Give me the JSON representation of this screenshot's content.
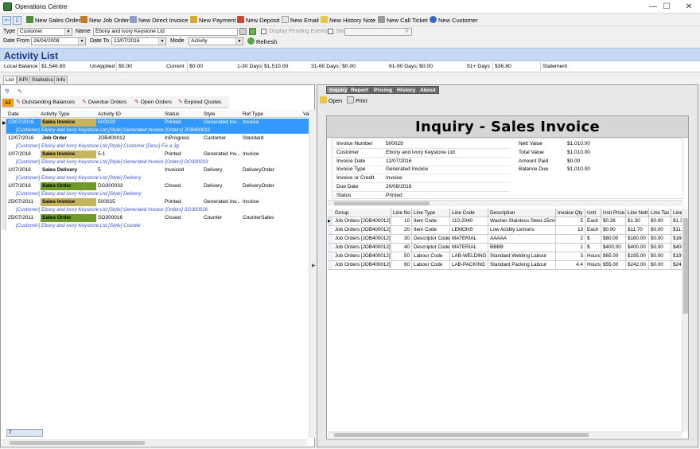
{
  "window": {
    "title": "Operations Centre",
    "minimize": "—",
    "maximize": "☐",
    "close": "✕"
  },
  "toolbar": {
    "new_sales_order": "New Sales Order",
    "new_job_order": "New Job Order",
    "new_direct_invoice": "New Direct Invoice",
    "new_payment": "New Payment",
    "new_deposit": "New Deposit",
    "new_email": "New Email",
    "new_history_note": "New History Note",
    "new_call_ticket": "New Call Ticket",
    "new_customer": "New Customer"
  },
  "filters": {
    "type_label": "Type",
    "type_value": "Customer",
    "name_label": "Name",
    "name_value": "Ebony and Ivory Keystone Ltd",
    "display_pending_label": "Display Pending Events",
    "site_label": "Site",
    "date_from_label": "Date From",
    "date_from_value": "26/04/2008",
    "date_to_label": "Date To",
    "date_to_value": "13/07/2016",
    "mode_label": "Mode",
    "mode_value": "Activity",
    "refresh_label": "Refresh"
  },
  "header": {
    "title": "Activity List"
  },
  "balances": {
    "local_balance_label": "Local Balance",
    "local_balance": "$1,546.80",
    "unapplied_label": "UnApplied",
    "unapplied": "$0.00",
    "current_label": "Current",
    "current": "$0.00",
    "d1_30_label": "1-30 Days",
    "d1_30": "$1,510.00",
    "d31_60_label": "31-60 Days",
    "d31_60": "$0.00",
    "d61_90_label": "61-90 Days",
    "d61_90": "$0.00",
    "d91_label": "91+ Days",
    "d91": "$36.80",
    "statement_label": "Statement"
  },
  "main_tabs": [
    "List",
    "KPI",
    "Statistics",
    "Info"
  ],
  "report_tabs": {
    "all": "All",
    "outstanding": "Outstanding Balances",
    "overdue": "Overdue Orders",
    "open": "Open Orders",
    "expired": "Expired Quotes"
  },
  "list_columns": [
    "Date",
    "Activity Type",
    "Activity ID",
    "Status",
    "Style",
    "Ref Type",
    "Val"
  ],
  "activities": [
    {
      "date": "12/07/2016",
      "type": "Sales Invoice",
      "id": "500029",
      "status": "Printed",
      "style": "Generated Inv...",
      "ref": "Invoice",
      "color": "#c8b45c",
      "sub": "[Customer] Ebony and Ivory Keystone Ltd [Style] Generated Invoice [Orders] JOB400012"
    },
    {
      "date": "12/07/2016",
      "type": "Job Order",
      "id": "JOB400012",
      "status": "InProgress",
      "style": "Customer",
      "ref": "Standard",
      "color": "",
      "sub": "[Customer] Ebony and Ivory Keystone Ltd [Style] Customer [Desc] Fix a 3g"
    },
    {
      "date": "1/07/2016",
      "type": "Sales Invoice",
      "id": "5-1",
      "status": "Printed",
      "style": "Generated Inv...",
      "ref": "Invoice",
      "color": "#c8b45c",
      "sub": "[Customer] Ebony and Ivory Keystone Ltd [Style] Generated Invoice [Orders] DO300033"
    },
    {
      "date": "1/07/2016",
      "type": "Sales Delivery",
      "id": "5",
      "status": "Invoiced",
      "style": "Delivery",
      "ref": "DeliveryOrder",
      "color": "",
      "sub": "[Customer] Ebony and Ivory Keystone Ltd [Style] Delivery"
    },
    {
      "date": "1/07/2016",
      "type": "Sales Order",
      "id": "DO300033",
      "status": "Closed",
      "style": "Delivery",
      "ref": "DeliveryOrder",
      "color": "#6e9a2a",
      "sub": "[Customer] Ebony and Ivory Keystone Ltd [Style] Delivery"
    },
    {
      "date": "25/07/2011",
      "type": "Sales Invoice",
      "id": "500025",
      "status": "Printed",
      "style": "Generated Inv...",
      "ref": "Invoice",
      "color": "#c8b45c",
      "sub": "[Customer] Ebony and Ivory Keystone Ltd [Style] Generated Invoice [Orders] SO300016"
    },
    {
      "date": "25/07/2011",
      "type": "Sales Order",
      "id": "SO300016",
      "status": "Closed",
      "style": "Counter",
      "ref": "CounterSales",
      "color": "#6e9a2a",
      "sub": "[Customer] Ebony and Ivory Keystone Ltd [Style] Counter"
    }
  ],
  "footer_count": "7",
  "right_tabs": [
    "Inquiry",
    "Report",
    "Pricing",
    "History",
    "About"
  ],
  "right_toolbar": {
    "open": "Open",
    "print": "Print"
  },
  "inquiry": {
    "title": "Inquiry - Sales Invoice",
    "fields": [
      {
        "label": "Invoice Number",
        "value": "500029"
      },
      {
        "label": "Customer",
        "value": "Ebony and Ivory Keystone Ltd"
      },
      {
        "label": "Invoice Date",
        "value": "12/07/2016"
      },
      {
        "label": "Invoice Type",
        "value": "Generated Invoice"
      },
      {
        "label": "Invoice or Credit",
        "value": "Invoice"
      },
      {
        "label": "Due Date",
        "value": "20/08/2016"
      },
      {
        "label": "Status",
        "value": "Printed"
      }
    ],
    "totals": [
      {
        "label": "Nett Value",
        "value": "$1,010.00"
      },
      {
        "label": "Total Value",
        "value": "$1,010.00"
      },
      {
        "label": "Amount Paid",
        "value": "$0.00"
      },
      {
        "label": "Balance Due",
        "value": "$1,010.00"
      }
    ],
    "line_columns": [
      "Group",
      "Line No",
      "Line Type",
      "Line Code",
      "Description",
      "Invoice Qty",
      "Unit",
      "Unit Price",
      "Line Nett",
      "Line Tax",
      "Line"
    ],
    "lines": [
      {
        "group": "Job Orders [JOB400012]",
        "no": "10",
        "type": "Item Code",
        "code": "110-2040",
        "desc": "Washer-Stainless Steel-15mm",
        "qty": "5",
        "unit": "Each",
        "price": "$0.26",
        "nett": "$1.30",
        "tax": "$0.00",
        "line": "$1.3("
      },
      {
        "group": "Job Orders [JOB400012]",
        "no": "20",
        "type": "Item Code",
        "code": "LEMONS",
        "desc": "Low Acidity Lemons",
        "qty": "13",
        "unit": "Each",
        "price": "$0.90",
        "nett": "$11.70",
        "tax": "$0.00",
        "line": "$11."
      },
      {
        "group": "Job Orders [JOB400012]",
        "no": "30",
        "type": "Descriptor Code",
        "code": "MATERIAL",
        "desc": "AAAAA",
        "qty": "2",
        "unit": "$",
        "price": "$80.00",
        "nett": "$160.00",
        "tax": "$0.00",
        "line": "$160"
      },
      {
        "group": "Job Orders [JOB400012]",
        "no": "40",
        "type": "Descriptor Code",
        "code": "MATERIAL",
        "desc": "BBBB",
        "qty": "1",
        "unit": "$",
        "price": "$400.00",
        "nett": "$400.00",
        "tax": "$0.00",
        "line": "$400"
      },
      {
        "group": "Job Orders [JOB400012]",
        "no": "50",
        "type": "Labour Code",
        "code": "LAB-WELDING",
        "desc": "Standard Welding Labour",
        "qty": "3",
        "unit": "Hours",
        "price": "$65.00",
        "nett": "$195.00",
        "tax": "$0.00",
        "line": "$195"
      },
      {
        "group": "Job Orders [JOB400012]",
        "no": "60",
        "type": "Labour Code",
        "code": "LAB-PACKING",
        "desc": "Standard Packing Labour",
        "qty": "4.4",
        "unit": "Hours",
        "price": "$55.00",
        "nett": "$242.00",
        "tax": "$0.00",
        "line": "$242"
      }
    ]
  }
}
